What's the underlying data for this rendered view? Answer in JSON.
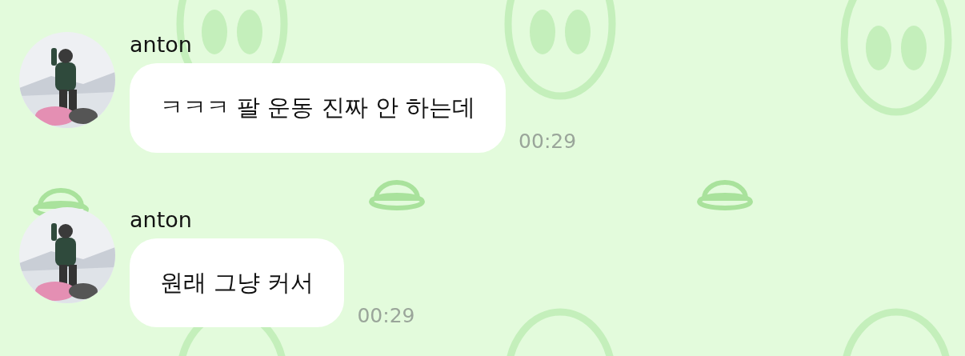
{
  "messages": [
    {
      "sender": "anton",
      "text": "ㅋㅋㅋ 팔 운동 진짜 안 하는데",
      "time": "00:29"
    },
    {
      "sender": "anton",
      "text": "원래 그냥 커서",
      "time": "00:29"
    }
  ]
}
